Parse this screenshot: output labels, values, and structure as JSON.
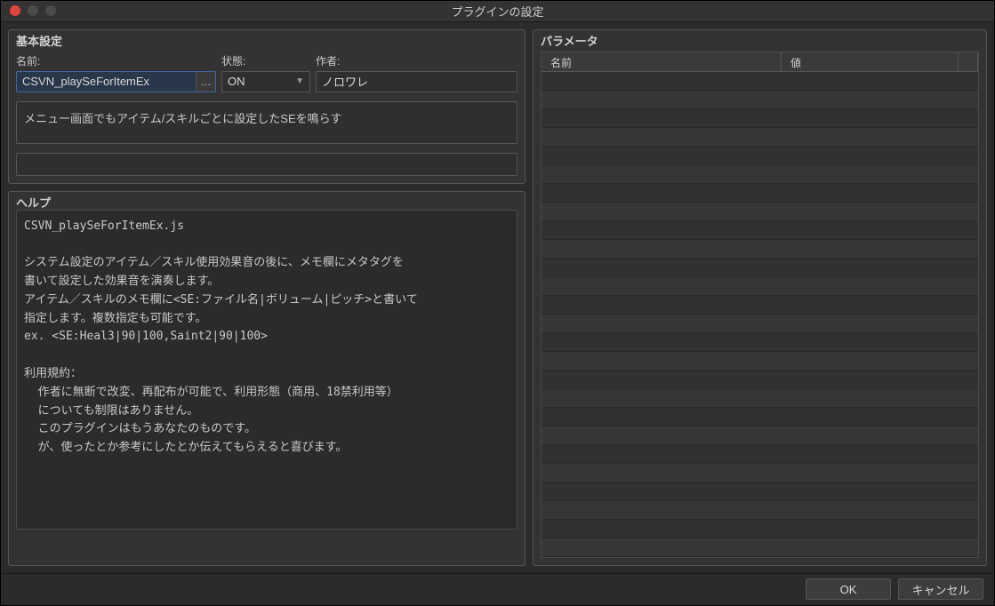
{
  "window": {
    "title": "プラグインの設定"
  },
  "basic": {
    "title": "基本設定",
    "name_label": "名前:",
    "name_value": "CSVN_playSeForItemEx",
    "status_label": "状態:",
    "status_value": "ON",
    "author_label": "作者:",
    "author_value": "ノロワレ",
    "description": "メニュー画面でもアイテム/スキルごとに設定したSEを鳴らす"
  },
  "help": {
    "title": "ヘルプ",
    "content": "CSVN_playSeForItemEx.js\n\nシステム設定のアイテム／スキル使用効果音の後に、メモ欄にメタタグを\n書いて設定した効果音を演奏します。\nアイテム／スキルのメモ欄に<SE:ファイル名|ボリューム|ピッチ>と書いて\n指定します。複数指定も可能です。\nex. <SE:Heal3|90|100,Saint2|90|100>\n\n利用規約：\n  作者に無断で改変、再配布が可能で、利用形態（商用、18禁利用等）\n  についても制限はありません。\n  このプラグインはもうあなたのものです。\n  が、使ったとか参考にしたとか伝えてもらえると喜びます。"
  },
  "params": {
    "title": "パラメータ",
    "header_name": "名前",
    "header_value": "値"
  },
  "footer": {
    "ok": "OK",
    "cancel": "キャンセル"
  }
}
